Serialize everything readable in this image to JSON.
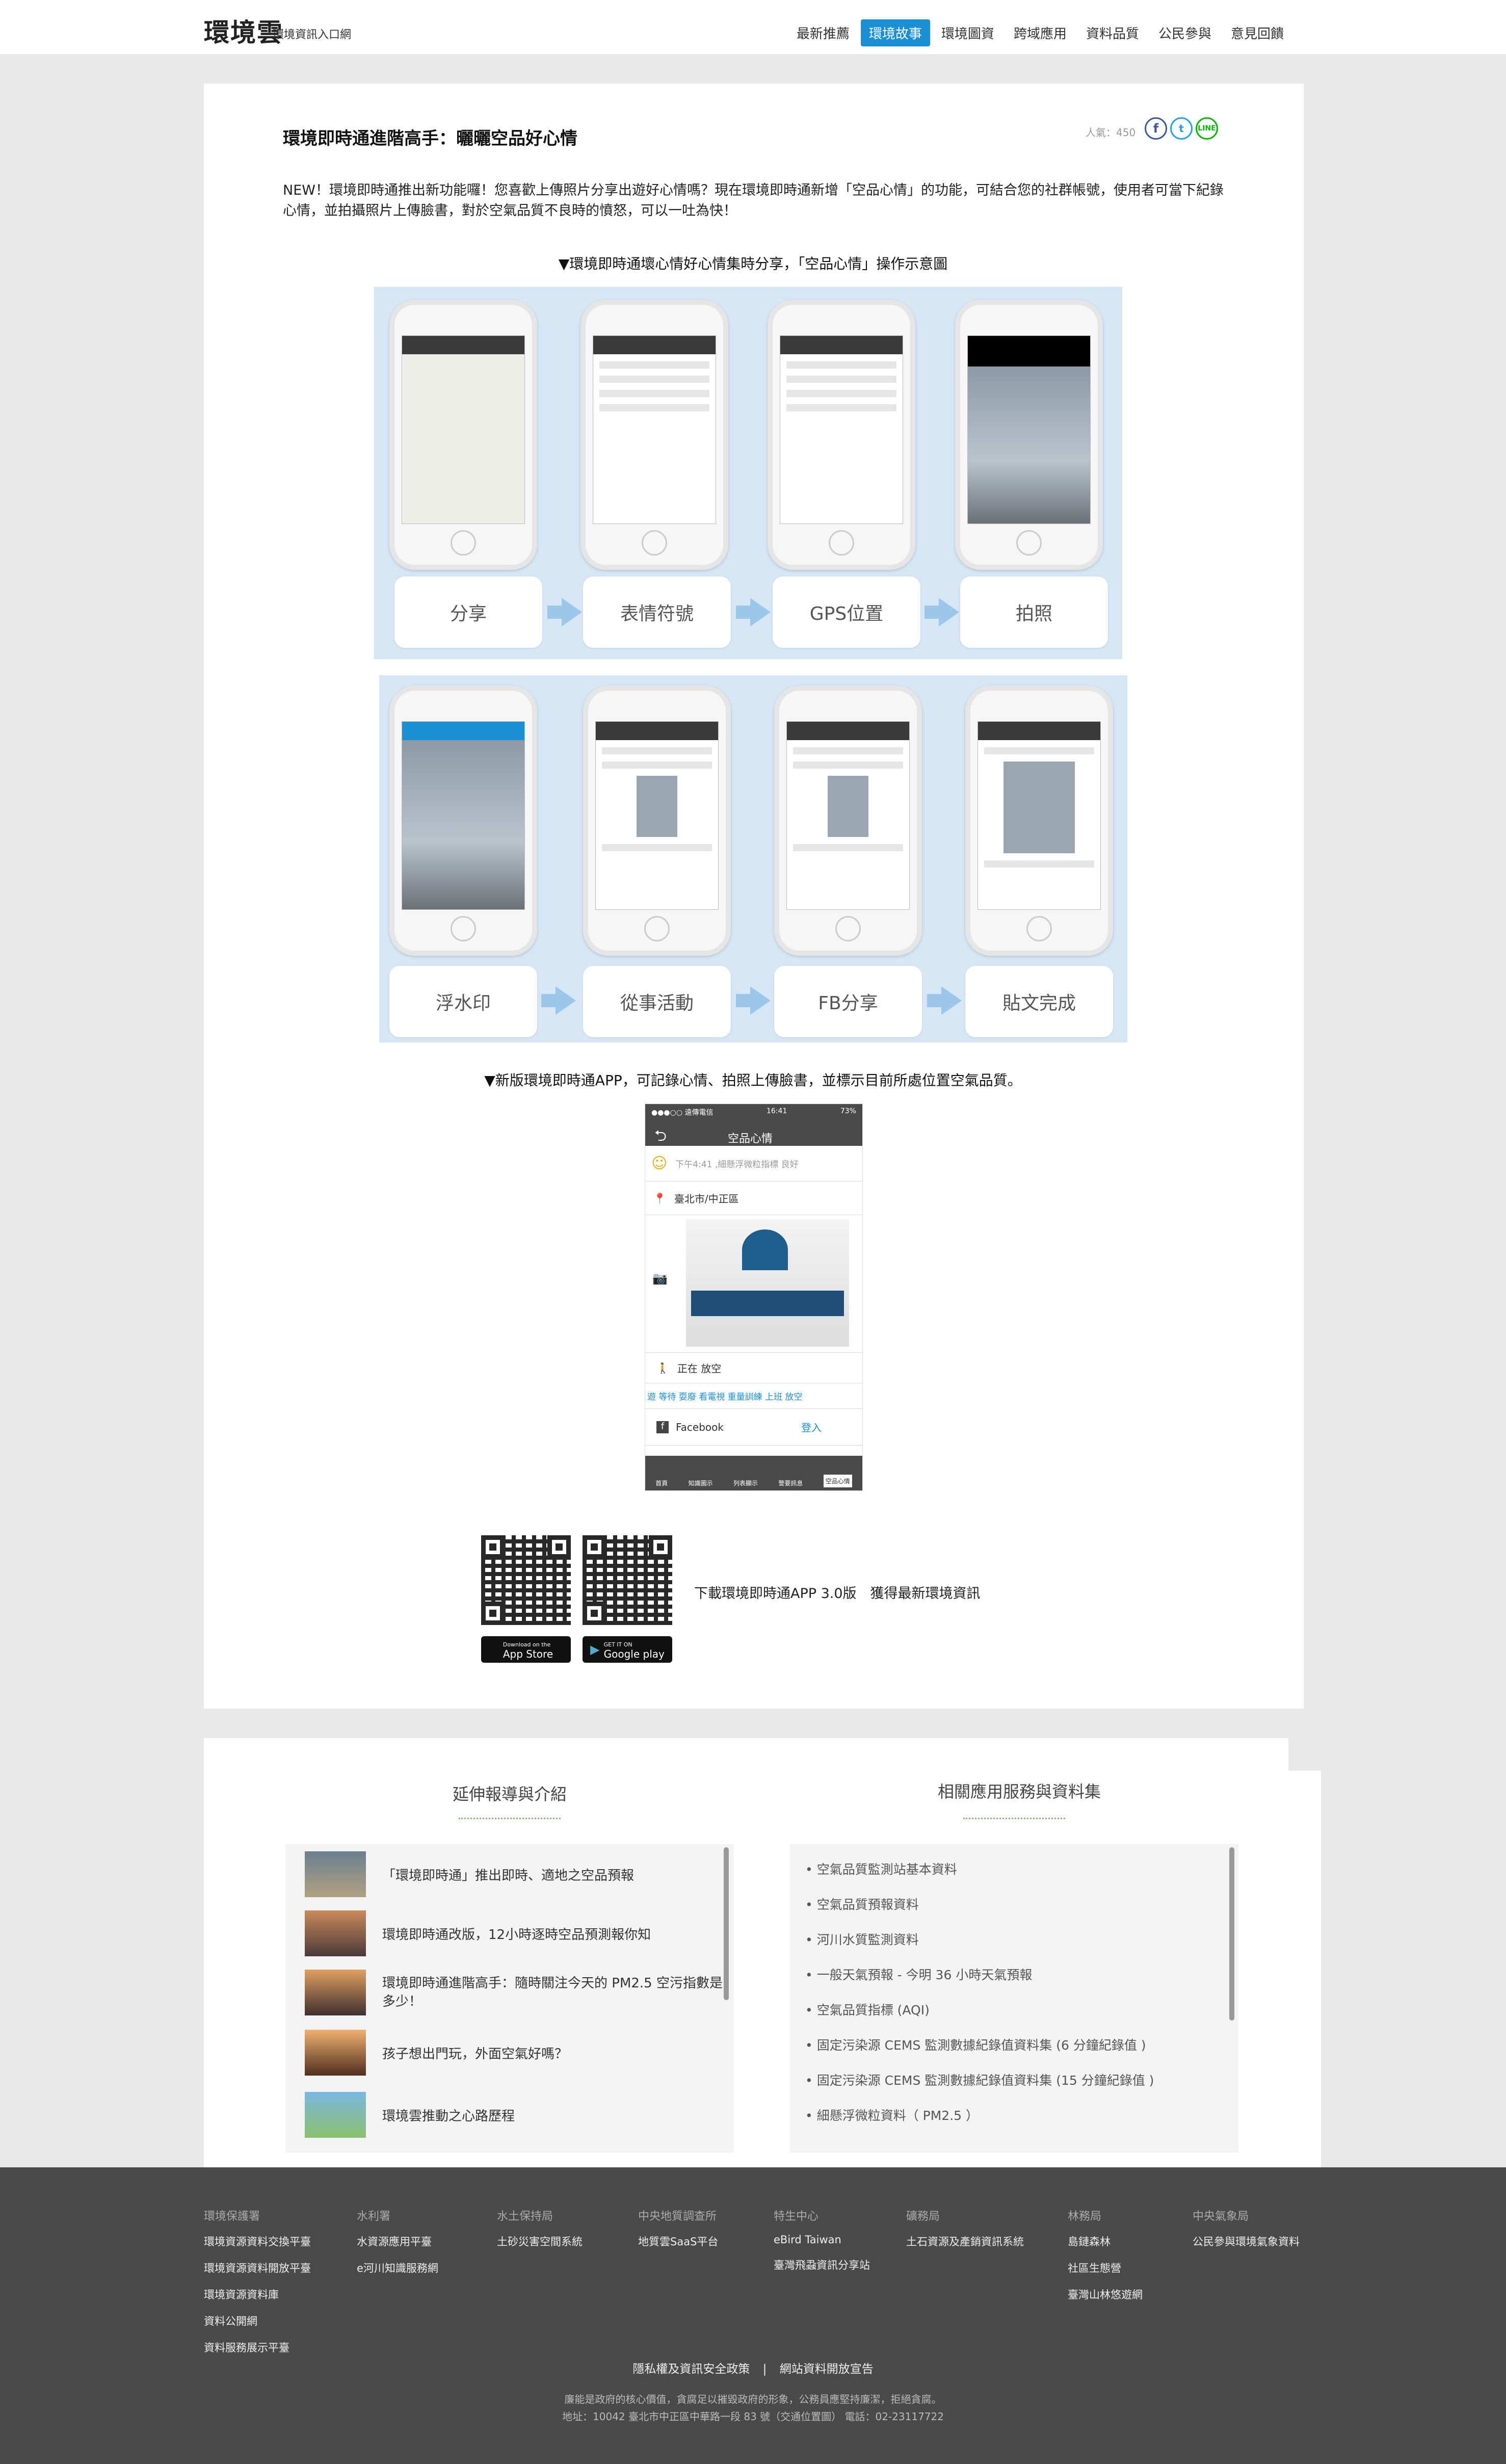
{
  "header": {
    "logo": "環境雲",
    "logo_sub": "環境資訊入口網",
    "nav": [
      "最新推薦",
      "環境故事",
      "環境圖資",
      "跨域應用",
      "資料品質",
      "公民參與",
      "意見回饋"
    ],
    "active_nav": "環境故事"
  },
  "article": {
    "title": "環境即時通進階高手：曬曬空品好心情",
    "views": "人氣：450",
    "share_icons": [
      "facebook-icon",
      "twitter-icon",
      "line-icon"
    ],
    "paragraph": "NEW！環境即時通推出新功能囉！您喜歡上傳照片分享出遊好心情嗎？現在環境即時通新增「空品心情」的功能，可結合您的社群帳號，使用者可當下紀錄心情，並拍攝照片上傳臉書，對於空氣品質不良時的憤怒，可以一吐為快！",
    "caption1": "▼環境即時通壞心情好心情集時分享，「空品心情」操作示意圖",
    "steps_row1": [
      "分享",
      "表情符號",
      "GPS位置",
      "拍照"
    ],
    "steps_row2": [
      "浮水印",
      "從事活動",
      "FB分享",
      "貼文完成"
    ],
    "caption2": "▼新版環境即時通APP，可記錄心情、拍照上傳臉書，並標示目前所處位置空氣品質。",
    "app": {
      "carrier": "●●●○○ 遠傳電信",
      "time": "16:41",
      "battery": "73%",
      "screen_title": "空品心情",
      "mood_text": "下午4:41 ,細懸浮微粒指標 良好",
      "location": "臺北市/中正區",
      "activity": "正在 放空",
      "activities": "遊  等待  耍廢  看電視  重量訓練  上班  放空",
      "facebook": "Facebook",
      "login": "登入",
      "tabs": [
        "首頁",
        "知識圖示",
        "列表顯示",
        "警要訊息",
        "空品心情"
      ]
    },
    "download_text": "下載環境即時通APP 3.0版　獲得最新環境資訊",
    "store_labels": [
      "App Store",
      "Google play"
    ],
    "store_small": [
      "Download on the",
      "GET IT ON"
    ]
  },
  "related": {
    "left_title": "延伸報導與介紹",
    "right_title": "相關應用服務與資料集",
    "stories": [
      "「環境即時通」推出即時、適地之空品預報",
      "環境即時通改版，12小時逐時空品預測報你知",
      "環境即時通進階高手：隨時關注今天的 PM2.5 空污指數是多少！",
      "孩子想出門玩，外面空氣好嗎？",
      "環境雲推動之心路歷程"
    ],
    "datasets": [
      "• 空氣品質監測站基本資料",
      "• 空氣品質預報資料",
      "• 河川水質監測資料",
      "• 一般天氣預報 - 今明 36 小時天氣預報",
      "• 空氣品質指標 (AQI)",
      "• 固定污染源 CEMS 監測數據紀錄值資料集 (6 分鐘紀錄值 )",
      "• 固定污染源 CEMS 監測數據紀錄值資料集 (15 分鐘紀錄值 )",
      "• 細懸浮微粒資料（ PM2.5 ）"
    ]
  },
  "footer": {
    "columns": [
      {
        "head": "環境保護署",
        "links": [
          "環境資源資料交換平臺",
          "環境資源資料開放平臺",
          "環境資源資料庫",
          "資料公開網",
          "資料服務展示平臺"
        ]
      },
      {
        "head": "水利署",
        "links": [
          "水資源應用平臺",
          "e河川知識服務網"
        ]
      },
      {
        "head": "水土保持局",
        "links": [
          "土砂災害空間系統"
        ]
      },
      {
        "head": "中央地質調查所",
        "links": [
          "地質雲SaaS平台"
        ]
      },
      {
        "head": "特生中心",
        "links": [
          "eBird Taiwan",
          "臺灣飛蝨資訊分享站"
        ]
      },
      {
        "head": "礦務局",
        "links": [
          "土石資源及產銷資訊系統"
        ]
      },
      {
        "head": "林務局",
        "links": [
          "島鏈森林",
          "社區生態營",
          "臺灣山林悠遊網"
        ]
      },
      {
        "head": "中央氣象局",
        "links": [
          "公民參與環境氣象資料"
        ]
      }
    ],
    "policy": "隱私權及資訊安全政策",
    "separator": "|",
    "open_data": "網站資料開放宣告",
    "note1": "廉能是政府的核心價值，貪腐足以摧毀政府的形象，公務員應堅持廉潔，拒絕貪腐。",
    "note2": "地址：10042 臺北市中正區中華路一段 83 號（交通位置圖）  電話：02-23117722"
  },
  "colors": {
    "accent": "#1a8fd6",
    "green": "#7fc36a",
    "footer_bg": "#4a4a4a",
    "page_bg": "#e9e9e9"
  }
}
